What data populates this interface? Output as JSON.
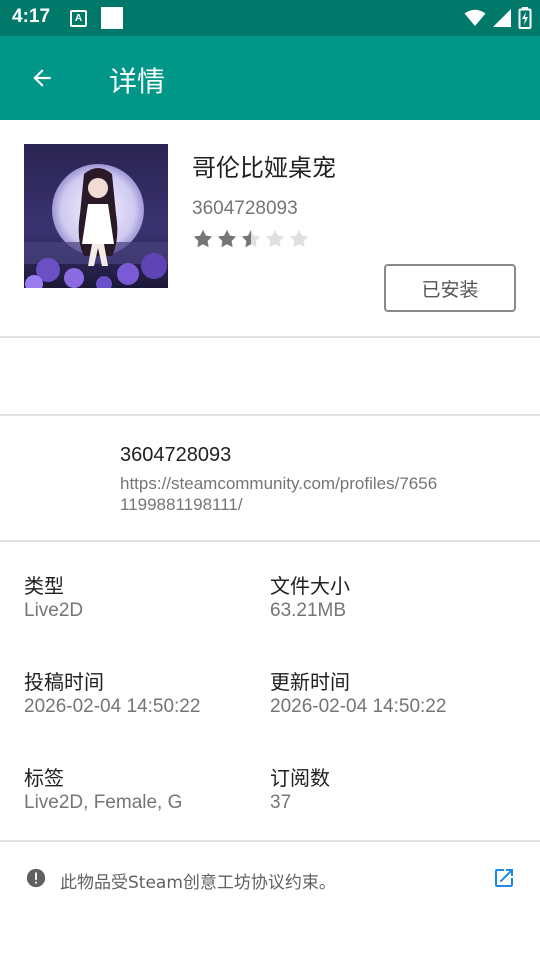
{
  "status_bar": {
    "time": "4:17",
    "notification_icon_letter": "A",
    "icons": [
      "wifi-icon",
      "signal-icon",
      "battery-charging-icon"
    ]
  },
  "app_bar": {
    "title": "详情",
    "back_icon": "arrow-back-icon"
  },
  "item": {
    "title": "哥伦比娅桌宠",
    "id": "3604728093",
    "rating": 2.5,
    "rating_max": 5,
    "action_label": "已安装"
  },
  "author": {
    "name": "3604728093",
    "url": "https://steamcommunity.com/profiles/76561199881198111/"
  },
  "info": {
    "type_label": "类型",
    "type_value": "Live2D",
    "size_label": "文件大小",
    "size_value": "63.21MB",
    "posted_label": "投稿时间",
    "posted_value": "2026-02-04 14:50:22",
    "updated_label": "更新时间",
    "updated_value": "2026-02-04 14:50:22",
    "tags_label": "标签",
    "tags_value": "Live2D, Female, G",
    "subscriptions_label": "订阅数",
    "subscriptions_value": "37"
  },
  "notice": {
    "text": "此物品受Steam创意工坊协议约束。",
    "icon": "alert-circle-icon",
    "link_icon": "open-in-new-icon"
  },
  "colors": {
    "status_bar": "#00796b",
    "app_bar": "#009688",
    "link_accent": "#1e88e5",
    "star_filled": "#757575",
    "star_empty": "#e0e0e0"
  }
}
